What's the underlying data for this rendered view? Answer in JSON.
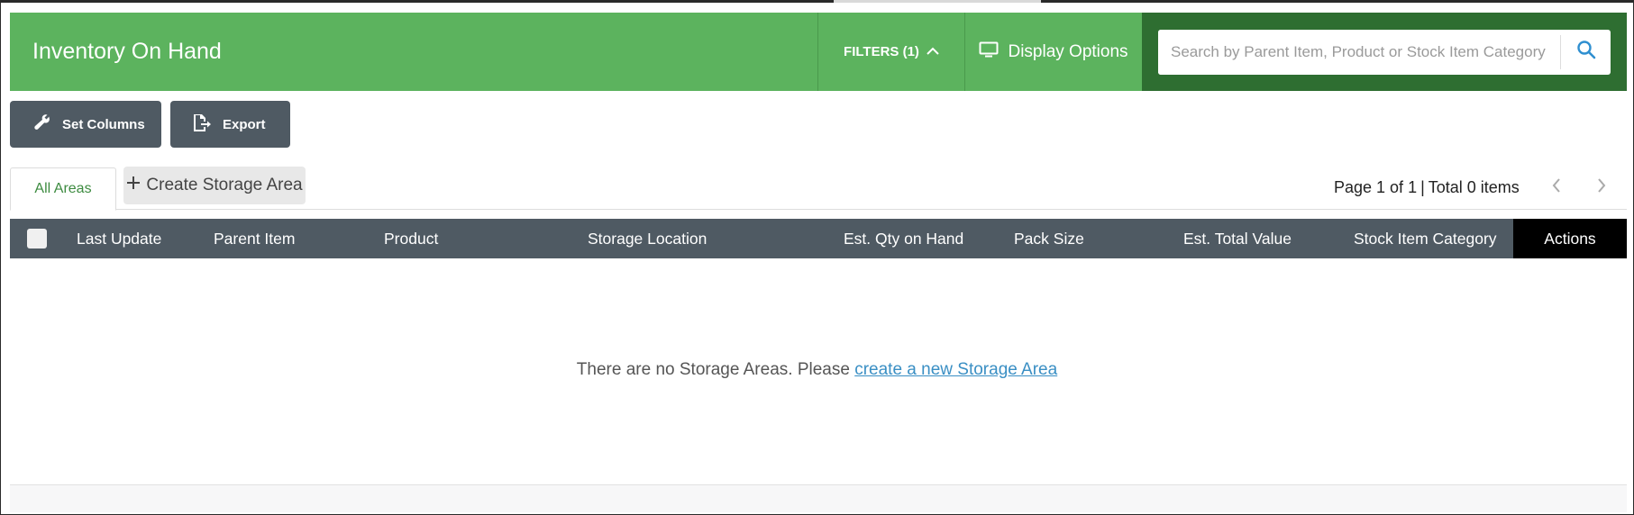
{
  "header": {
    "title": "Inventory On Hand",
    "filters_label": "FILTERS (1)",
    "display_options_label": "Display Options",
    "search_placeholder": "Search by Parent Item, Product or Stock Item Category"
  },
  "toolbar": {
    "set_columns_label": "Set Columns",
    "export_label": "Export"
  },
  "tabs": {
    "all_areas_label": "All Areas",
    "create_storage_area_label": "Create Storage Area"
  },
  "pager": {
    "page_text": "Page 1 of 1",
    "separator": "|",
    "total_text": "Total 0 items"
  },
  "table": {
    "columns": [
      "Last Update",
      "Parent Item",
      "Product",
      "Storage Location",
      "Est. Qty on Hand",
      "Pack Size",
      "Est. Total Value",
      "Stock Item Category",
      "Actions"
    ]
  },
  "empty_state": {
    "message": "There are no Storage Areas. Please",
    "link": "create a new Storage Area"
  },
  "colors": {
    "header_green": "#5cb35e",
    "search_band_green": "#2e6e31",
    "toolbar_slate": "#4f5a63",
    "link_blue": "#3a8fc4",
    "active_tab_green": "#3d8b40"
  },
  "icons": {
    "filters": "chevron-up-icon",
    "display_options": "monitor-icon",
    "search": "search-icon",
    "set_columns": "wrench-icon",
    "export": "export-file-icon",
    "create": "plus-icon",
    "prev": "chevron-left-icon",
    "next": "chevron-right-icon"
  }
}
